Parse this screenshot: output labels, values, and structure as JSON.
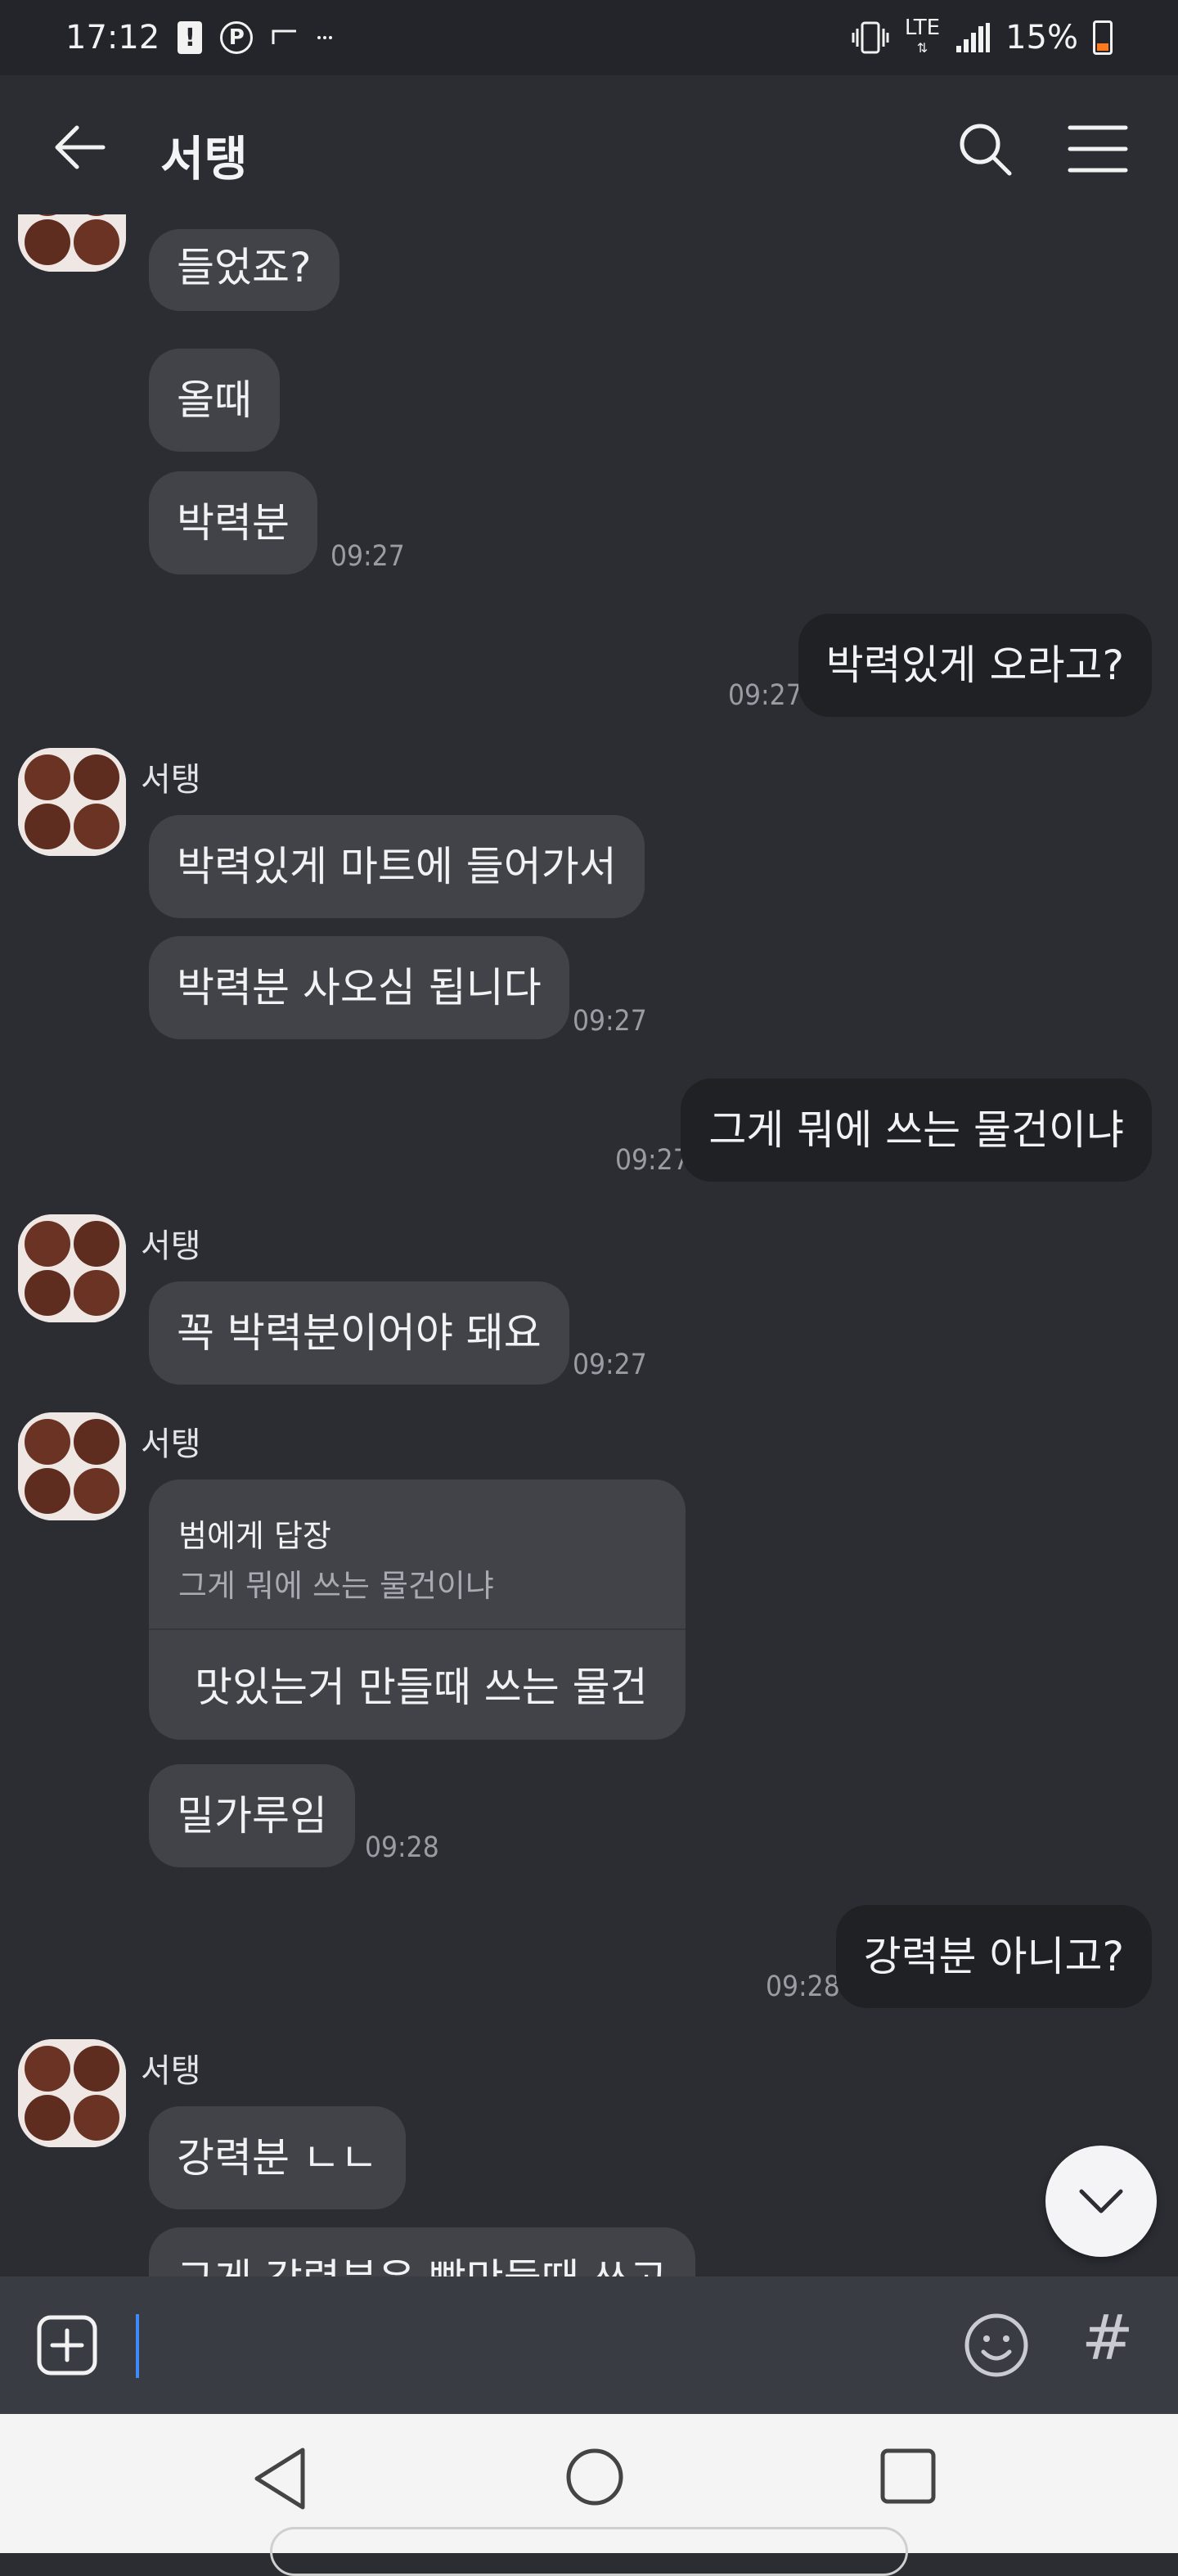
{
  "status_bar": {
    "time": "17:12",
    "network": "LTE",
    "battery": "15%",
    "icons": [
      "alert-badge-icon",
      "parking-icon",
      "cast-icon",
      "more-dots-icon",
      "vibrate-icon",
      "lte-icon",
      "signal-icon",
      "battery-icon"
    ],
    "battery_color": "#ff7a1a"
  },
  "header": {
    "title": "서탱",
    "back_icon": "arrow-left-icon",
    "search_icon": "search-icon",
    "menu_icon": "hamburger-menu-icon"
  },
  "messages": [
    {
      "from": "other",
      "text": "들었죠?"
    },
    {
      "from": "other",
      "text": "올때"
    },
    {
      "from": "other",
      "text": "박력분",
      "time": "09:27"
    },
    {
      "from": "me",
      "text": "박력있게 오라고?",
      "time": "09:27"
    },
    {
      "from": "other",
      "sender": "서탱",
      "text": "박력있게 마트에 들어가서"
    },
    {
      "from": "other",
      "text": "박력분 사오심 됩니다",
      "time": "09:27"
    },
    {
      "from": "me",
      "text": "그게 뭐에 쓰는 물건이냐",
      "time": "09:27"
    },
    {
      "from": "other",
      "sender": "서탱",
      "text": "꼭 박력분이어야 돼요",
      "time": "09:27"
    },
    {
      "from": "other",
      "sender": "서탱",
      "reply_to": "범에게 답장",
      "reply_quote": "그게 뭐에 쓰는 물건이냐",
      "text": "맛있는거 만들때 쓰는 물건"
    },
    {
      "from": "other",
      "text": "밀가루임",
      "time": "09:28"
    },
    {
      "from": "me",
      "text": "강력분 아니고?",
      "time": "09:28"
    },
    {
      "from": "other",
      "sender": "서탱",
      "text": "강력분 ㄴㄴ"
    },
    {
      "from": "other",
      "text": "그게 강력분은 빵만들때 쓰고"
    }
  ],
  "composer": {
    "value": "",
    "plus_icon": "plus-square-icon",
    "emoji_icon": "emoji-icon",
    "hash_symbol": "#"
  },
  "scroll_down_icon": "chevron-down-icon",
  "nav": {
    "icons": [
      "nav-back-icon",
      "nav-home-icon",
      "nav-recents-icon"
    ]
  },
  "colors": {
    "background": "#2b2d33",
    "bubble_other": "#414349",
    "bubble_me": "#1f2125",
    "caret": "#3d8bff"
  }
}
